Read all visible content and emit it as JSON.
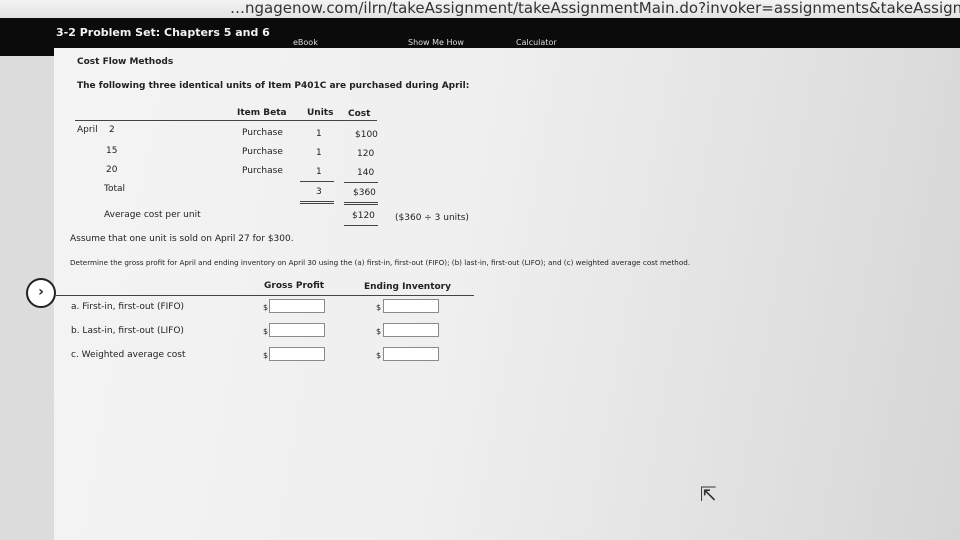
{
  "browser": {
    "url": "…ngagenow.com/ilrn/takeAssignment/takeAssignmentMain.do?invoker=assignments&takeAssignmentSessionLocator="
  },
  "header": {
    "title": "3-2 Problem Set: Chapters 5 and 6",
    "ebook": "eBook",
    "show_me_how": "Show Me How",
    "calculator": "Calculator"
  },
  "problem": {
    "heading": "Cost Flow Methods",
    "intro": "The following three identical units of Item P401C are purchased during April:",
    "table": {
      "headers": [
        "Item Beta",
        "Units",
        "Cost"
      ],
      "month": "April",
      "rows": [
        {
          "day": "2",
          "item": "Purchase",
          "units": "1",
          "cost": "$100"
        },
        {
          "day": "15",
          "item": "Purchase",
          "units": "1",
          "cost": "120"
        },
        {
          "day": "20",
          "item": "Purchase",
          "units": "1",
          "cost": "140"
        }
      ],
      "total_label": "Total",
      "total_units": "3",
      "total_cost": "$360",
      "avg_label": "Average cost per unit",
      "avg_value": "$120",
      "avg_note": "($360 ÷ 3 units)"
    },
    "assume": "Assume that one unit is sold on April 27 for $300.",
    "determine": "Determine the gross profit for April and ending inventory on April 30 using the (a) first-in, first-out (FIFO); (b) last-in, first-out (LIFO); and (c) weighted average cost method.",
    "answer_headers": {
      "gross_profit": "Gross Profit",
      "ending_inventory": "Ending Inventory"
    },
    "answers": [
      {
        "label": "a. First-in, first-out (FIFO)",
        "gross_profit": "",
        "ending_inventory": ""
      },
      {
        "label": "b. Last-in, first-out (LIFO)",
        "gross_profit": "",
        "ending_inventory": ""
      },
      {
        "label": "c. Weighted average cost",
        "gross_profit": "",
        "ending_inventory": ""
      }
    ],
    "currency_symbol": "$"
  },
  "icons": {
    "nav": "chevron-right-icon",
    "cursor": "mouse-pointer-icon"
  }
}
